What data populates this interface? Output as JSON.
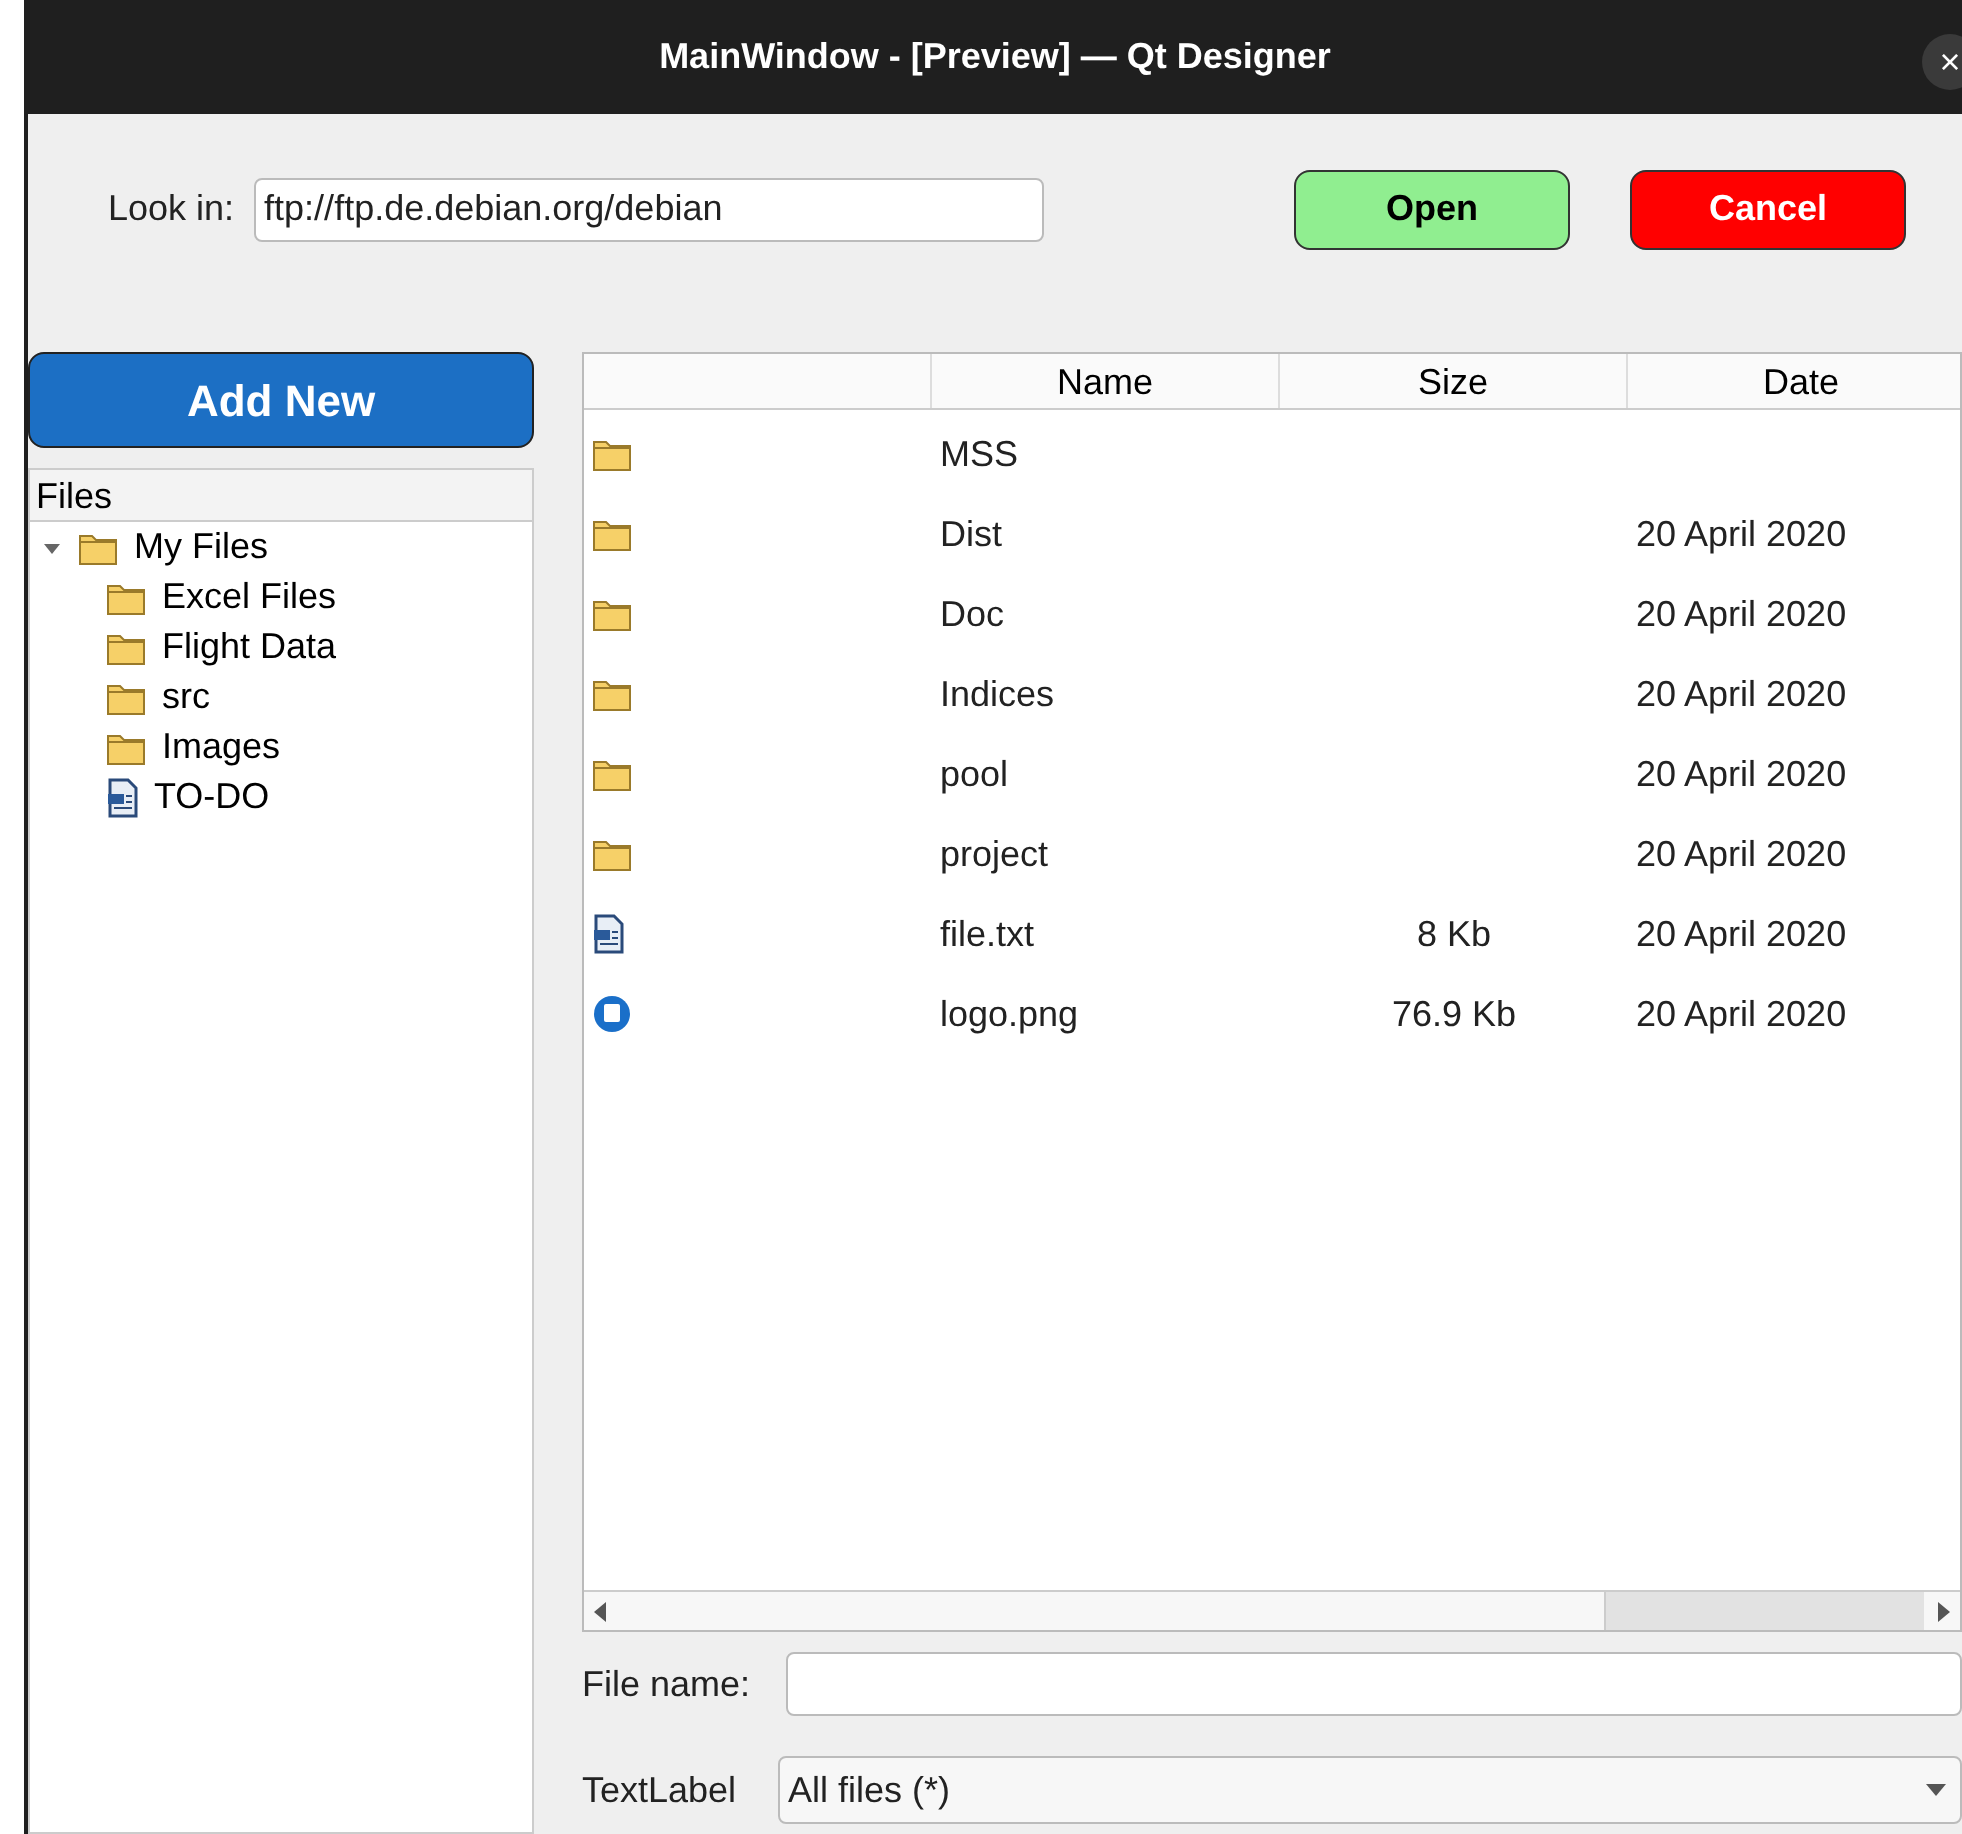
{
  "window": {
    "title": "MainWindow - [Preview] — Qt Designer",
    "close": "×"
  },
  "look_in": {
    "label": "Look in:",
    "value": "ftp://ftp.de.debian.org/debian"
  },
  "buttons": [
    {
      "label": "Open",
      "kind": "open"
    },
    {
      "label": "Cancel",
      "kind": "cancel"
    }
  ],
  "add_new": {
    "label": "Add New"
  },
  "tree": {
    "header": "Files",
    "items": [
      {
        "label": "My Files",
        "kind": "folder",
        "expanded": true,
        "children": [
          {
            "label": "Excel Files",
            "kind": "folder"
          },
          {
            "label": "Flight Data",
            "kind": "folder"
          },
          {
            "label": "src",
            "kind": "folder"
          },
          {
            "label": "Images",
            "kind": "folder"
          },
          {
            "label": "TO-DO",
            "kind": "text"
          }
        ]
      }
    ]
  },
  "table": {
    "columns": [
      "",
      "Name",
      "Size",
      "Date"
    ],
    "rows": [
      {
        "kind": "folder",
        "name": "MSS",
        "size": "",
        "date": ""
      },
      {
        "kind": "folder",
        "name": "Dist",
        "size": "",
        "date": "20 April 2020"
      },
      {
        "kind": "folder",
        "name": "Doc",
        "size": "",
        "date": "20 April 2020"
      },
      {
        "kind": "folder",
        "name": "Indices",
        "size": "",
        "date": "20 April 2020"
      },
      {
        "kind": "folder",
        "name": "pool",
        "size": "",
        "date": "20 April 2020"
      },
      {
        "kind": "folder",
        "name": "project",
        "size": "",
        "date": "20 April 2020"
      },
      {
        "kind": "text",
        "name": "file.txt",
        "size": "8 Kb",
        "date": "20 April 2020"
      },
      {
        "kind": "image",
        "name": "logo.png",
        "size": "76.9 Kb",
        "date": "20 April 2020"
      }
    ]
  },
  "file_name": {
    "label": "File name:"
  },
  "filter": {
    "label": "TextLabel",
    "value": "All files (*)"
  }
}
